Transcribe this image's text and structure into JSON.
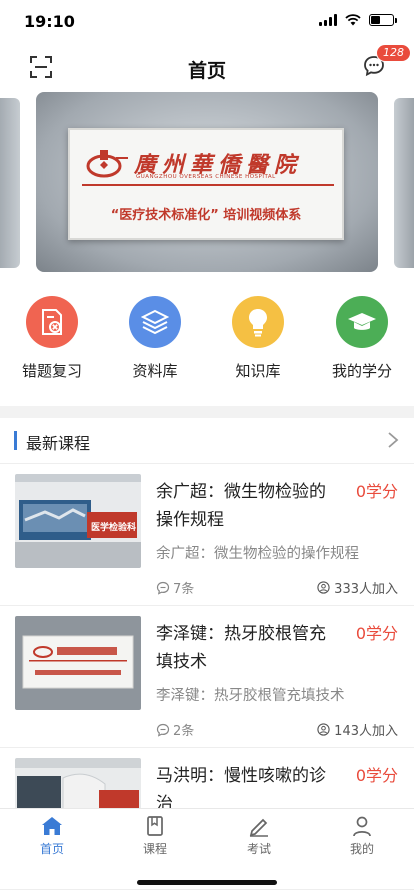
{
  "status_bar": {
    "time": "19:10"
  },
  "header": {
    "title": "首页",
    "message_badge": "128"
  },
  "banner": {
    "hospital_name": "廣州華僑醫院",
    "hospital_name_en": "GUANGZHOU OVERSEAS CHINESE HOSPITAL",
    "slogan": "“医疗技术标准化” 培训视频体系"
  },
  "quick_entries": [
    {
      "label": "错题复习",
      "icon": "wrong-questions-icon",
      "color": "#f06451"
    },
    {
      "label": "资料库",
      "icon": "library-layers-icon",
      "color": "#5a8ee6"
    },
    {
      "label": "知识库",
      "icon": "lightbulb-icon",
      "color": "#f5c043"
    },
    {
      "label": "我的学分",
      "icon": "graduation-cap-icon",
      "color": "#4cae56"
    }
  ],
  "section": {
    "title": "最新课程"
  },
  "courses": [
    {
      "title": "余广超：微生物检验的操作规程",
      "credit": "0学分",
      "subtitle": "余广超：微生物检验的操作规程",
      "comments": "7条",
      "joined": "333人加入"
    },
    {
      "title": "李泽键：热牙胶根管充填技术",
      "credit": "0学分",
      "subtitle": "李泽键：热牙胶根管充填技术",
      "comments": "2条",
      "joined": "143人加入"
    },
    {
      "title": "马洪明：慢性咳嗽的诊治",
      "credit": "0学分",
      "subtitle": "",
      "comments": "",
      "joined": ""
    }
  ],
  "thumb_text": {
    "course1": "医学检验科"
  },
  "tabs": [
    {
      "label": "首页",
      "icon": "home-icon",
      "active": true
    },
    {
      "label": "课程",
      "icon": "book-icon",
      "active": false
    },
    {
      "label": "考试",
      "icon": "pencil-icon",
      "active": false
    },
    {
      "label": "我的",
      "icon": "person-icon",
      "active": false
    }
  ],
  "colors": {
    "accent": "#3a7bd5",
    "credit_red": "#e94b3c",
    "banner_red": "#c0392b"
  }
}
